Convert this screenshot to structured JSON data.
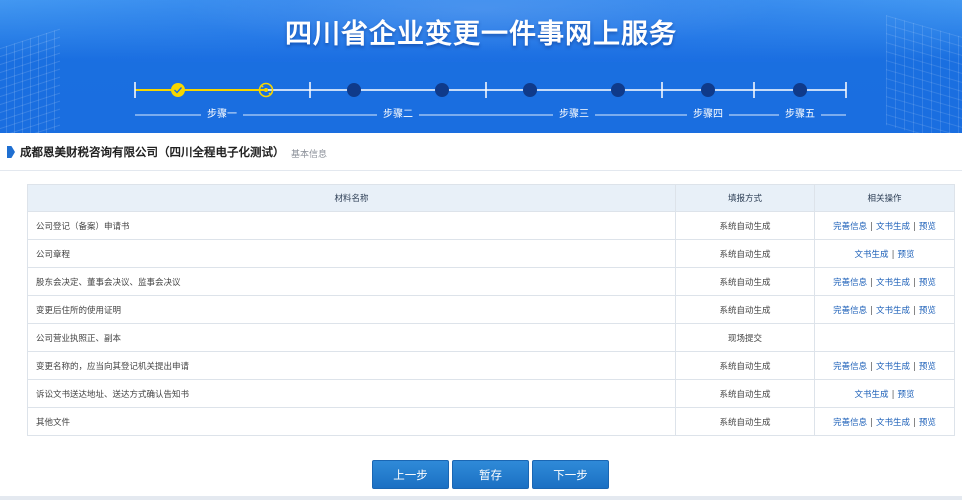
{
  "banner": {
    "title": "四川省企业变更一件事网上服务"
  },
  "stepper": {
    "steps": [
      {
        "label": "步骤一"
      },
      {
        "label": "步骤二"
      },
      {
        "label": "步骤三"
      },
      {
        "label": "步骤四"
      },
      {
        "label": "步骤五"
      }
    ],
    "colors": {
      "done": "#f7d600",
      "pending": "#0f3a8a",
      "rail": "#ffffff"
    }
  },
  "company": {
    "name": "成都恩美财税咨询有限公司（四川全程电子化测试）",
    "tag": "基本信息"
  },
  "table": {
    "headers": [
      "材料名称",
      "填报方式",
      "相关操作"
    ],
    "rows": [
      {
        "name": "公司登记（备案）申请书",
        "method": "系统自动生成",
        "ops": [
          "完善信息",
          "文书生成",
          "预览"
        ]
      },
      {
        "name": "公司章程",
        "method": "系统自动生成",
        "ops": [
          "文书生成",
          "预览"
        ]
      },
      {
        "name": "股东会决定、董事会决议、监事会决议",
        "method": "系统自动生成",
        "ops": [
          "完善信息",
          "文书生成",
          "预览"
        ]
      },
      {
        "name": "变更后住所的使用证明",
        "method": "系统自动生成",
        "ops": [
          "完善信息",
          "文书生成",
          "预览"
        ]
      },
      {
        "name": "公司营业执照正、副本",
        "method": "现场提交",
        "ops": []
      },
      {
        "name": "变更名称的，应当向其登记机关提出申请",
        "method": "系统自动生成",
        "ops": [
          "完善信息",
          "文书生成",
          "预览"
        ]
      },
      {
        "name": "诉讼文书送达地址、送达方式确认告知书",
        "method": "系统自动生成",
        "ops": [
          "文书生成",
          "预览"
        ]
      },
      {
        "name": "其他文件",
        "method": "系统自动生成",
        "ops": [
          "完善信息",
          "文书生成",
          "预览"
        ]
      }
    ]
  },
  "buttons": {
    "prev": "上一步",
    "save": "暂存",
    "next": "下一步"
  },
  "colors": {
    "banner": "#1a6ee0",
    "button": "#1b70c3",
    "link": "#1b5fb8",
    "header_bg": "#e8f0f8"
  }
}
